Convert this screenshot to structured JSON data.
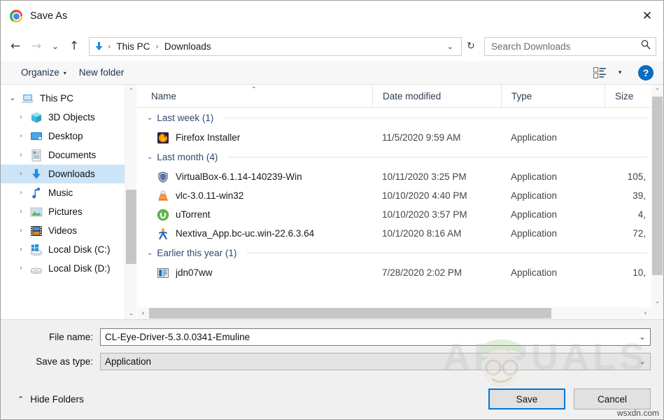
{
  "window": {
    "title": "Save As",
    "app_icon": "chrome-icon",
    "close_label": "✕"
  },
  "nav": {
    "back": "←",
    "forward": "→",
    "recent": "⌄",
    "up": "↑",
    "refresh": "↻",
    "address_dropdown": "⌄",
    "breadcrumbs": [
      "This PC",
      "Downloads"
    ],
    "separator": "›"
  },
  "search": {
    "placeholder": "Search Downloads",
    "value": "",
    "icon": "search-icon"
  },
  "commandbar": {
    "organize_label": "Organize",
    "organize_caret": "▾",
    "new_folder_label": "New folder",
    "view_icon": "list-view-icon",
    "view_caret": "▾",
    "help_label": "?"
  },
  "sidebar": {
    "items": [
      {
        "label": "This PC",
        "icon": "computer-icon",
        "level": 1,
        "expander": "⌄",
        "expanded": true,
        "selected": false
      },
      {
        "label": "3D Objects",
        "icon": "cube-icon",
        "level": 2,
        "expander": "›",
        "expanded": false,
        "selected": false
      },
      {
        "label": "Desktop",
        "icon": "desktop-icon",
        "level": 2,
        "expander": "›",
        "expanded": false,
        "selected": false
      },
      {
        "label": "Documents",
        "icon": "documents-icon",
        "level": 2,
        "expander": "›",
        "expanded": false,
        "selected": false
      },
      {
        "label": "Downloads",
        "icon": "downloads-icon",
        "level": 2,
        "expander": "›",
        "expanded": false,
        "selected": true
      },
      {
        "label": "Music",
        "icon": "music-icon",
        "level": 2,
        "expander": "›",
        "expanded": false,
        "selected": false
      },
      {
        "label": "Pictures",
        "icon": "pictures-icon",
        "level": 2,
        "expander": "›",
        "expanded": false,
        "selected": false
      },
      {
        "label": "Videos",
        "icon": "videos-icon",
        "level": 2,
        "expander": "›",
        "expanded": false,
        "selected": false
      },
      {
        "label": "Local Disk (C:)",
        "icon": "windows-disk-icon",
        "level": 2,
        "expander": "›",
        "expanded": false,
        "selected": false
      },
      {
        "label": "Local Disk (D:)",
        "icon": "disk-icon",
        "level": 2,
        "expander": "›",
        "expanded": false,
        "selected": false
      }
    ],
    "scroll_up": "⌃",
    "scroll_down": "⌄"
  },
  "filelist": {
    "columns": [
      {
        "label": "Name",
        "sorted": true,
        "sort_indicator": "⌄"
      },
      {
        "label": "Date modified",
        "sorted": false,
        "sort_indicator": ""
      },
      {
        "label": "Type",
        "sorted": false,
        "sort_indicator": ""
      },
      {
        "label": "Size",
        "sorted": false,
        "sort_indicator": ""
      }
    ],
    "groups": [
      {
        "label": "Last week (1)",
        "caret": "⌄",
        "rows": [
          {
            "name": "Firefox Installer",
            "icon": "firefox-icon",
            "date": "11/5/2020 9:59 AM",
            "type": "Application",
            "size": ""
          }
        ]
      },
      {
        "label": "Last month (4)",
        "caret": "⌄",
        "rows": [
          {
            "name": "VirtualBox-6.1.14-140239-Win",
            "icon": "virtualbox-icon",
            "date": "10/11/2020 3:25 PM",
            "type": "Application",
            "size": "105,"
          },
          {
            "name": "vlc-3.0.11-win32",
            "icon": "vlc-icon",
            "date": "10/10/2020 4:40 PM",
            "type": "Application",
            "size": "39,"
          },
          {
            "name": "uTorrent",
            "icon": "utorrent-icon",
            "date": "10/10/2020 3:57 PM",
            "type": "Application",
            "size": "4,"
          },
          {
            "name": "Nextiva_App.bc-uc.win-22.6.3.64",
            "icon": "nextiva-icon",
            "date": "10/1/2020 8:16 AM",
            "type": "Application",
            "size": "72,"
          }
        ]
      },
      {
        "label": "Earlier this year (1)",
        "caret": "⌄",
        "rows": [
          {
            "name": "jdn07ww",
            "icon": "generic-app-icon",
            "date": "7/28/2020 2:02 PM",
            "type": "Application",
            "size": "10,"
          }
        ]
      }
    ],
    "hscroll_left": "‹",
    "hscroll_right": "›",
    "vscroll_up": "⌃",
    "vscroll_down": "⌄"
  },
  "form": {
    "filename_label": "File name:",
    "filename_value": "CL-Eye-Driver-5.3.0.0341-Emuline",
    "savetype_label": "Save as type:",
    "savetype_value": "Application",
    "caret": "⌄"
  },
  "footer": {
    "hide_folders_label": "Hide Folders",
    "hide_folders_caret": "⌃",
    "save_label": "Save",
    "cancel_label": "Cancel"
  },
  "watermark": {
    "text": "APPUALS",
    "credit": "wsxdn.com"
  },
  "colors": {
    "accent": "#0078d7",
    "selection": "#cce4f7",
    "group_header_text": "#2f4a73",
    "help_blue": "#0a6cc4",
    "downloads_arrow": "#1f8ae0"
  }
}
